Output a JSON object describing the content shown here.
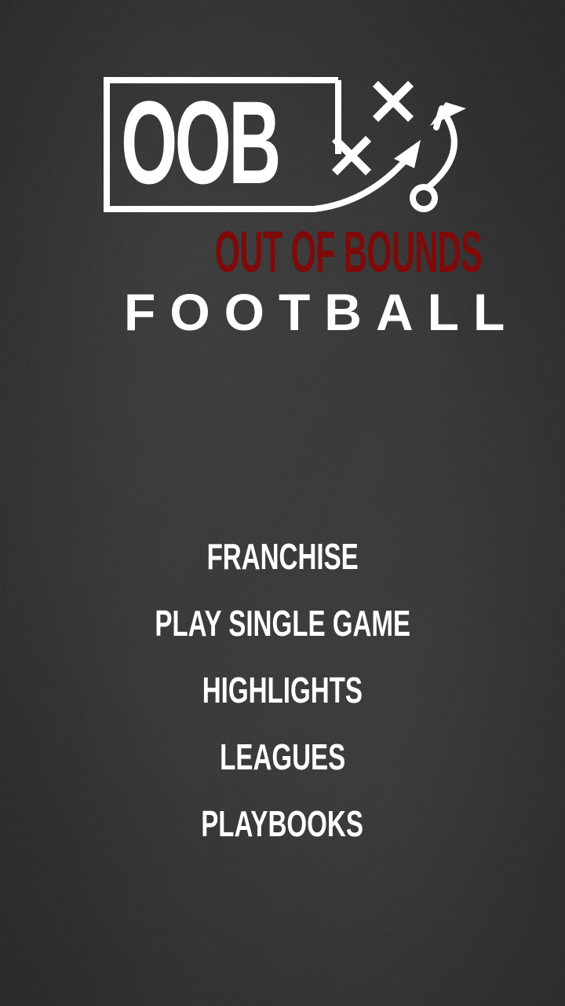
{
  "logo": {
    "abbreviation": "OOB",
    "subtitle": "OUT OF BOUNDS",
    "tagline": "FOOTBALL"
  },
  "menu": {
    "items": [
      {
        "label": "FRANCHISE"
      },
      {
        "label": "PLAY SINGLE GAME"
      },
      {
        "label": "HIGHLIGHTS"
      },
      {
        "label": "LEAGUES"
      },
      {
        "label": "PLAYBOOKS"
      }
    ]
  },
  "colors": {
    "background": "#2b2b2b",
    "text": "#ffffff",
    "accent_red": "#7e0a0a"
  },
  "icons": [
    "play-diagram-icon",
    "x-mark-icon",
    "arrow-route-icon"
  ]
}
